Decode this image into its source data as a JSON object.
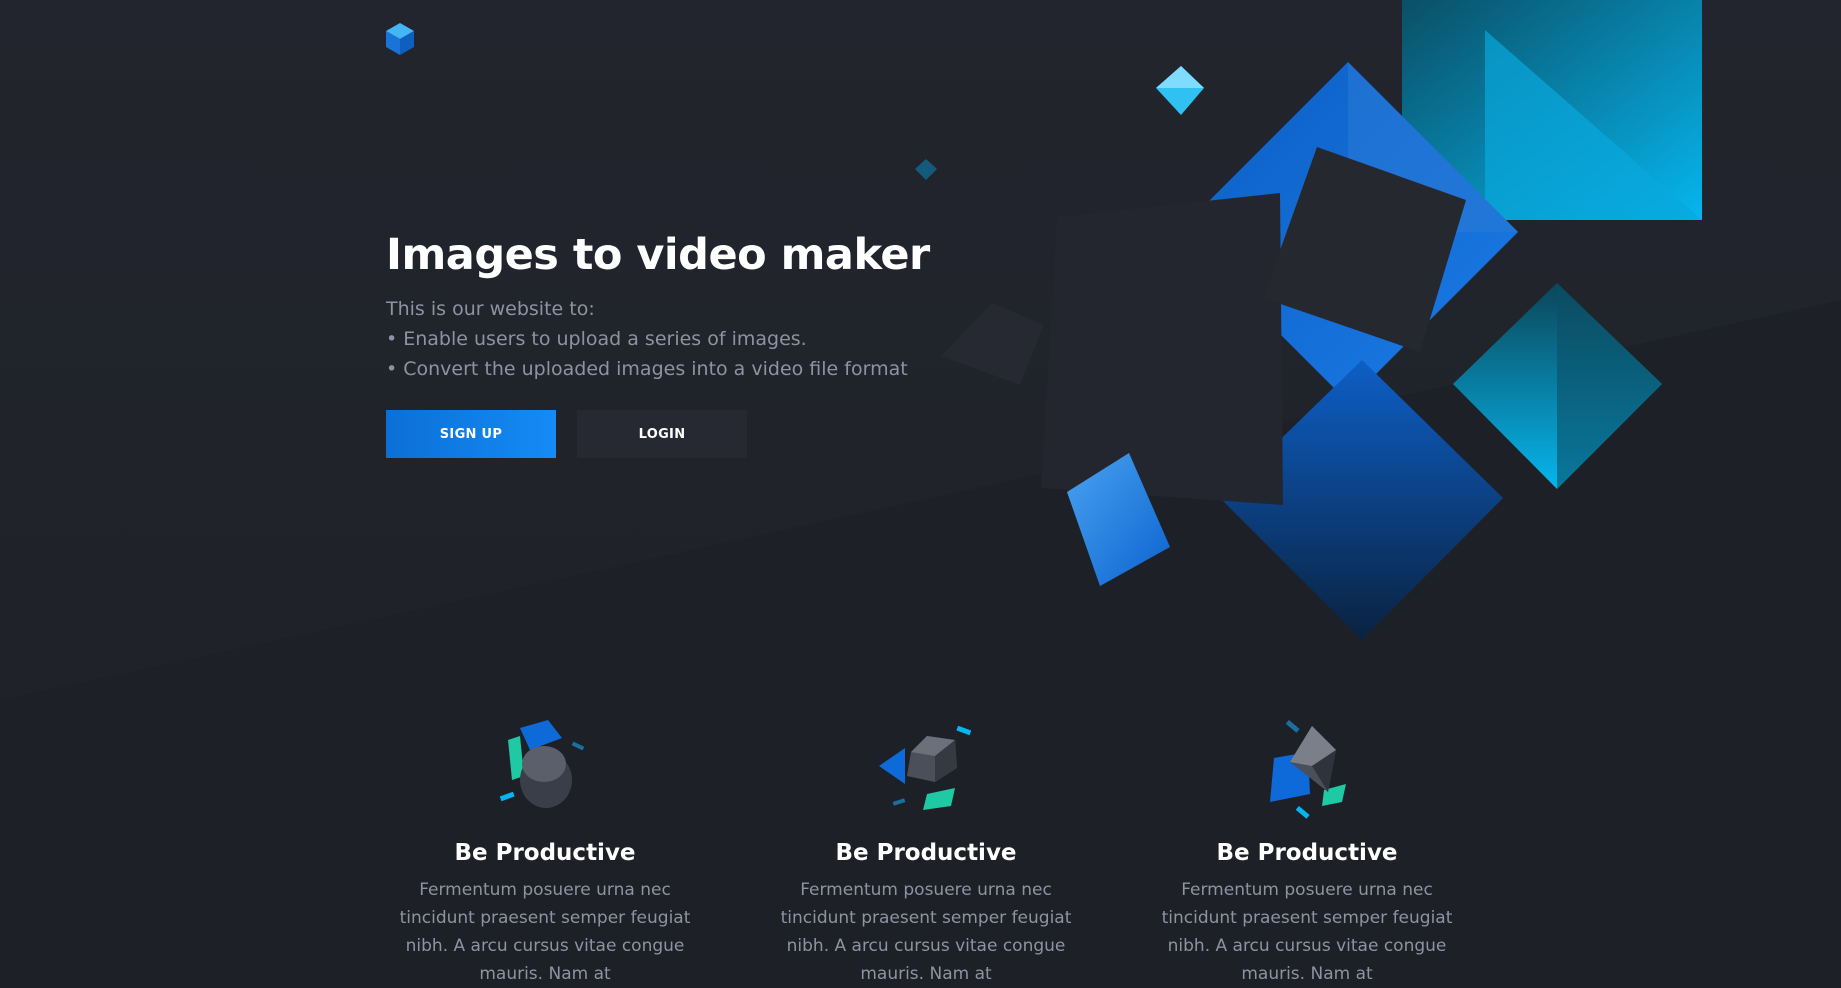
{
  "hero": {
    "title": "Images to video maker",
    "intro": "This is our website to:",
    "bullets": [
      "• Enable users to upload a series of images.",
      "• Convert the uploaded images into a video file format"
    ],
    "signup_label": "SIGN UP",
    "login_label": "LOGIN"
  },
  "features": [
    {
      "icon": "cylinder-shapes-icon",
      "title": "Be Productive",
      "text": "Fermentum posuere urna nec tincidunt praesent semper feugiat nibh. A arcu cursus vitae congue mauris. Nam at"
    },
    {
      "icon": "cube-shapes-icon",
      "title": "Be Productive",
      "text": "Fermentum posuere urna nec tincidunt praesent semper feugiat nibh. A arcu cursus vitae congue mauris. Nam at"
    },
    {
      "icon": "pyramid-shapes-icon",
      "title": "Be Productive",
      "text": "Fermentum posuere urna nec tincidunt praesent semper feugiat nibh. A arcu cursus vitae congue mauris. Nam at"
    }
  ],
  "colors": {
    "background": "#1e2027",
    "accent": "#0f82ee",
    "cyan": "#06b6ee",
    "teal": "#1fc9a4",
    "muted_text": "#8d93a3"
  }
}
